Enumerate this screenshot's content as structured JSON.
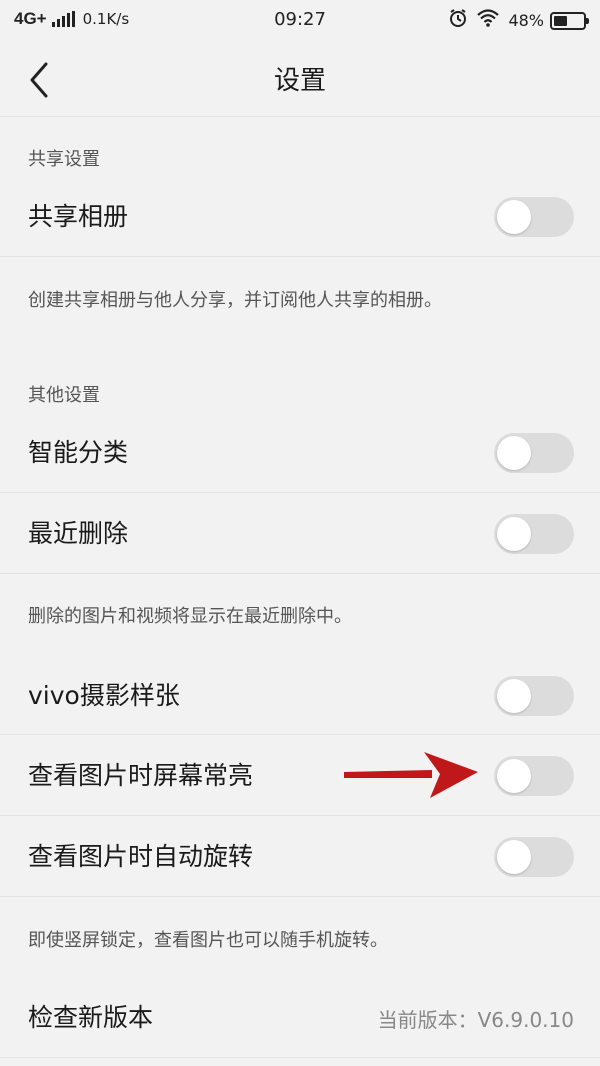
{
  "status_bar": {
    "network": "4G+",
    "speed": "0.1K/s",
    "time": "09:27",
    "battery": "48%",
    "battery_level": 0.48
  },
  "header": {
    "title": "设置"
  },
  "sections": {
    "sharing_label": "共享设置",
    "other_label": "其他设置"
  },
  "rows": {
    "shared_album": {
      "label": "共享相册",
      "on": false
    },
    "smart_classify": {
      "label": "智能分类",
      "on": false
    },
    "recently_deleted": {
      "label": "最近删除",
      "on": false
    },
    "vivo_photo_sample": {
      "label": "vivo摄影样张",
      "on": false
    },
    "screen_always_on": {
      "label": "查看图片时屏幕常亮",
      "on": false
    },
    "auto_rotate": {
      "label": "查看图片时自动旋转",
      "on": false
    },
    "check_update": {
      "label": "检查新版本",
      "value": "当前版本：V6.9.0.10"
    }
  },
  "descriptions": {
    "shared_album": "创建共享相册与他人分享，并订阅他人共享的相册。",
    "recently_deleted": "删除的图片和视频将显示在最近删除中。",
    "auto_rotate": "即使竖屏锁定，查看图片也可以随手机旋转。"
  },
  "colors": {
    "background": "#f2f2f2",
    "toggle_off": "#dcdcdc",
    "annotation_arrow": "#c0181a"
  }
}
